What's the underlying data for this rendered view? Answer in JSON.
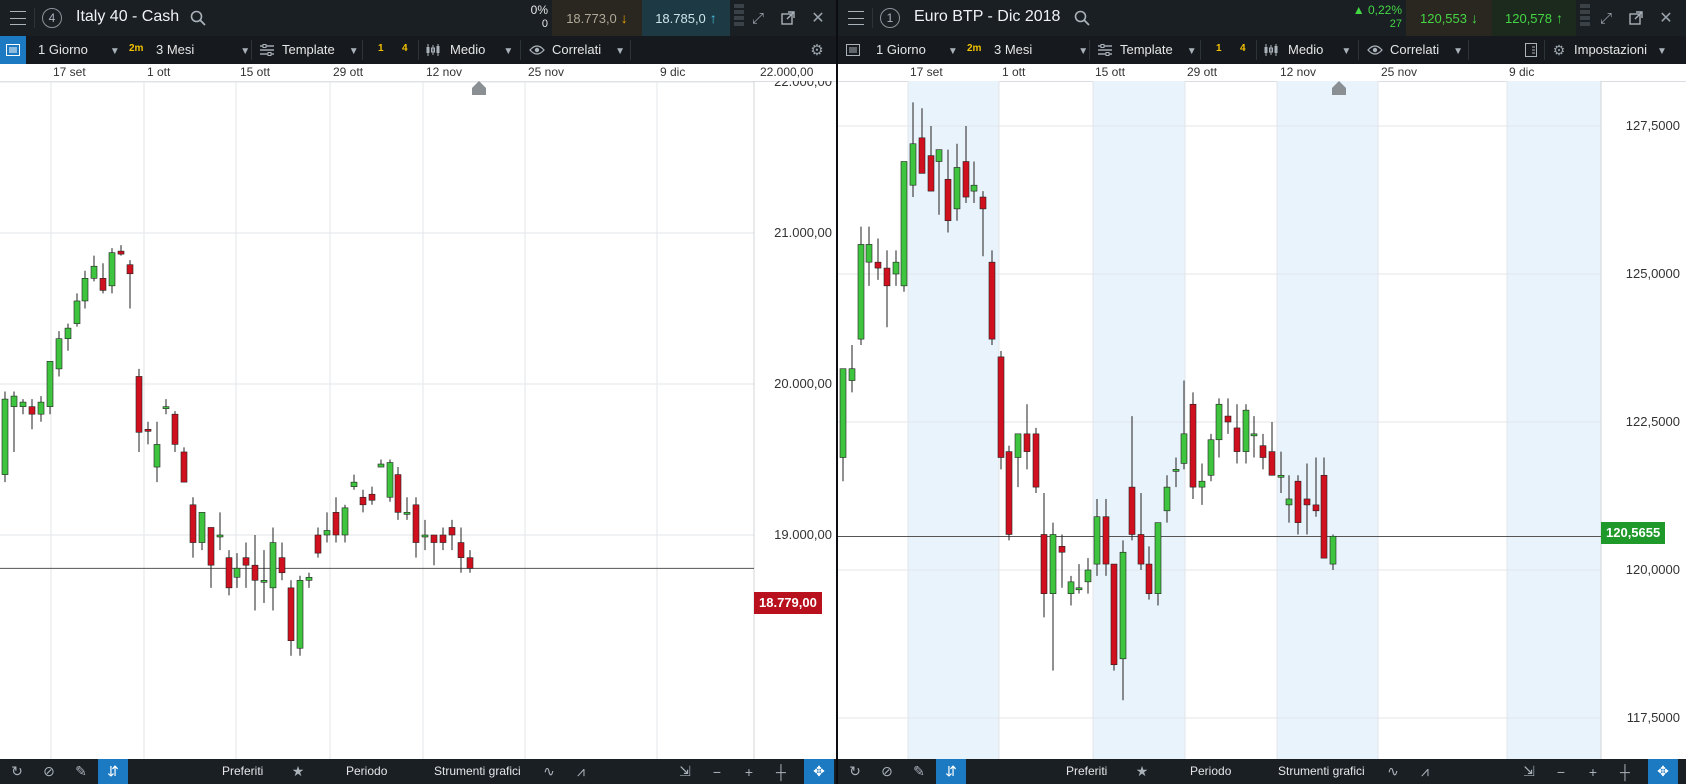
{
  "colors": {
    "up": "#3ec43e",
    "down": "#d0101e",
    "accent_blue": "#1c7ac2",
    "bg_dark": "#1a1f24",
    "bid_bg": "#2a2620",
    "ask_bg": "#1d3a44",
    "last_green_bg": "#1f9a2a",
    "last_red_bg": "#b8101c",
    "band": "#e9f3fc"
  },
  "left": {
    "badge": "4",
    "title": "Italy 40 - Cash",
    "change_pct": "0%",
    "change_pts": "0",
    "bid": "18.773,0",
    "ask": "18.785,0",
    "toolbar": {
      "period": "1 Giorno",
      "timeframe_badge": "2m",
      "range": "3 Mesi",
      "template": "Template",
      "ind1": "1",
      "ind2": "4",
      "style": "Medio",
      "correlati": "Correlati"
    },
    "x_ticks": [
      "17 set",
      "1 ott",
      "15 ott",
      "29 ott",
      "12 nov",
      "25 nov",
      "9 dic"
    ],
    "y_ticks": [
      "22.000,00",
      "21.000,00",
      "20.000,00",
      "19.000,00"
    ],
    "last_price": "18.779,00",
    "bottom": {
      "preferiti": "Preferiti",
      "periodo": "Periodo",
      "strumenti": "Strumenti grafici"
    }
  },
  "right": {
    "badge": "1",
    "title": "Euro BTP - Dic 2018",
    "change_pct": "0,22%",
    "change_pts": "27",
    "bid": "120,553",
    "ask": "120,578",
    "toolbar": {
      "period": "1 Giorno",
      "timeframe_badge": "2m",
      "range": "3 Mesi",
      "template": "Template",
      "ind1": "1",
      "ind2": "4",
      "style": "Medio",
      "correlati": "Correlati",
      "settings": "Impostazioni"
    },
    "x_ticks": [
      "17 set",
      "1 ott",
      "15 ott",
      "29 ott",
      "12 nov",
      "25 nov",
      "9 dic"
    ],
    "y_ticks": [
      "127,5000",
      "125,0000",
      "122,5000",
      "120,0000",
      "117,5000"
    ],
    "last_price": "120,5655",
    "bottom": {
      "preferiti": "Preferiti",
      "periodo": "Periodo",
      "strumenti": "Strumenti grafici"
    }
  },
  "chart_data": [
    {
      "type": "candlestick",
      "title": "Italy 40 - Cash",
      "ylim": [
        18200,
        22050
      ],
      "last": 18779,
      "candles": [
        {
          "o": 19400,
          "h": 19950,
          "l": 19350,
          "c": 19900
        },
        {
          "o": 19850,
          "h": 19950,
          "l": 19550,
          "c": 19920
        },
        {
          "o": 19850,
          "h": 19900,
          "l": 19800,
          "c": 19880
        },
        {
          "o": 19850,
          "h": 19900,
          "l": 19700,
          "c": 19800
        },
        {
          "o": 19800,
          "h": 19920,
          "l": 19750,
          "c": 19880
        },
        {
          "o": 19850,
          "h": 20150,
          "l": 19800,
          "c": 20150
        },
        {
          "o": 20100,
          "h": 20350,
          "l": 20050,
          "c": 20300
        },
        {
          "o": 20300,
          "h": 20400,
          "l": 20220,
          "c": 20370
        },
        {
          "o": 20400,
          "h": 20600,
          "l": 20380,
          "c": 20550
        },
        {
          "o": 20550,
          "h": 20750,
          "l": 20500,
          "c": 20700
        },
        {
          "o": 20700,
          "h": 20850,
          "l": 20680,
          "c": 20780
        },
        {
          "o": 20700,
          "h": 20800,
          "l": 20600,
          "c": 20620
        },
        {
          "o": 20650,
          "h": 20900,
          "l": 20600,
          "c": 20870
        },
        {
          "o": 20880,
          "h": 20920,
          "l": 20850,
          "c": 20860
        },
        {
          "o": 20790,
          "h": 20820,
          "l": 20500,
          "c": 20730
        },
        {
          "o": 20050,
          "h": 20100,
          "l": 19550,
          "c": 19680
        },
        {
          "o": 19700,
          "h": 19750,
          "l": 19600,
          "c": 19690
        },
        {
          "o": 19450,
          "h": 19750,
          "l": 19350,
          "c": 19600
        },
        {
          "o": 19850,
          "h": 19900,
          "l": 19800,
          "c": 19850
        },
        {
          "o": 19800,
          "h": 19820,
          "l": 19550,
          "c": 19600
        },
        {
          "o": 19550,
          "h": 19580,
          "l": 19350,
          "c": 19350
        },
        {
          "o": 19200,
          "h": 19250,
          "l": 18850,
          "c": 18950
        },
        {
          "o": 18950,
          "h": 19150,
          "l": 18900,
          "c": 19150
        },
        {
          "o": 19050,
          "h": 19050,
          "l": 18650,
          "c": 18800
        },
        {
          "o": 19000,
          "h": 19150,
          "l": 18900,
          "c": 19000
        },
        {
          "o": 18850,
          "h": 18900,
          "l": 18600,
          "c": 18650
        },
        {
          "o": 18720,
          "h": 18880,
          "l": 18650,
          "c": 18780
        },
        {
          "o": 18850,
          "h": 18950,
          "l": 18650,
          "c": 18800
        },
        {
          "o": 18800,
          "h": 19000,
          "l": 18500,
          "c": 18700
        },
        {
          "o": 18700,
          "h": 18900,
          "l": 18550,
          "c": 18700
        },
        {
          "o": 18650,
          "h": 19050,
          "l": 18500,
          "c": 18950
        },
        {
          "o": 18850,
          "h": 18950,
          "l": 18700,
          "c": 18750
        },
        {
          "o": 18650,
          "h": 18700,
          "l": 18200,
          "c": 18300
        },
        {
          "o": 18250,
          "h": 18730,
          "l": 18200,
          "c": 18700
        },
        {
          "o": 18700,
          "h": 18750,
          "l": 18650,
          "c": 18720
        },
        {
          "o": 19000,
          "h": 19050,
          "l": 18850,
          "c": 18880
        },
        {
          "o": 19000,
          "h": 19150,
          "l": 18950,
          "c": 19030
        },
        {
          "o": 19150,
          "h": 19250,
          "l": 18950,
          "c": 19000
        },
        {
          "o": 19000,
          "h": 19200,
          "l": 18950,
          "c": 19180
        },
        {
          "o": 19320,
          "h": 19400,
          "l": 19300,
          "c": 19350
        },
        {
          "o": 19250,
          "h": 19300,
          "l": 19150,
          "c": 19200
        },
        {
          "o": 19270,
          "h": 19320,
          "l": 19200,
          "c": 19230
        },
        {
          "o": 19450,
          "h": 19500,
          "l": 19450,
          "c": 19470
        },
        {
          "o": 19250,
          "h": 19500,
          "l": 19220,
          "c": 19480
        },
        {
          "o": 19400,
          "h": 19450,
          "l": 19100,
          "c": 19150
        },
        {
          "o": 19150,
          "h": 19250,
          "l": 19100,
          "c": 19150
        },
        {
          "o": 19200,
          "h": 19250,
          "l": 18850,
          "c": 18950
        },
        {
          "o": 19000,
          "h": 19100,
          "l": 18900,
          "c": 19000
        },
        {
          "o": 19000,
          "h": 19000,
          "l": 18800,
          "c": 18950
        },
        {
          "o": 19000,
          "h": 19050,
          "l": 18900,
          "c": 18950
        },
        {
          "o": 19050,
          "h": 19100,
          "l": 18900,
          "c": 19000
        },
        {
          "o": 18950,
          "h": 19050,
          "l": 18750,
          "c": 18850
        },
        {
          "o": 18850,
          "h": 18900,
          "l": 18750,
          "c": 18779
        }
      ]
    },
    {
      "type": "candlestick",
      "title": "Euro BTP - Dic 2018",
      "ylim": [
        117000,
        128500
      ],
      "last": 120.5655,
      "candles": [
        {
          "o": 121.9,
          "h": 123.0,
          "l": 121.5,
          "c": 123.4
        },
        {
          "o": 123.2,
          "h": 123.8,
          "l": 123.0,
          "c": 123.4
        },
        {
          "o": 123.9,
          "h": 125.8,
          "l": 123.8,
          "c": 125.5
        },
        {
          "o": 125.2,
          "h": 125.8,
          "l": 124.8,
          "c": 125.5
        },
        {
          "o": 125.2,
          "h": 125.6,
          "l": 124.9,
          "c": 125.1
        },
        {
          "o": 125.1,
          "h": 125.4,
          "l": 124.1,
          "c": 124.8
        },
        {
          "o": 125.0,
          "h": 125.4,
          "l": 124.8,
          "c": 125.2
        },
        {
          "o": 124.8,
          "h": 126.1,
          "l": 124.7,
          "c": 126.9
        },
        {
          "o": 126.5,
          "h": 127.9,
          "l": 126.3,
          "c": 127.2
        },
        {
          "o": 127.3,
          "h": 127.8,
          "l": 126.9,
          "c": 126.7
        },
        {
          "o": 127.0,
          "h": 127.5,
          "l": 126.4,
          "c": 126.4
        },
        {
          "o": 126.9,
          "h": 127.1,
          "l": 126.0,
          "c": 127.1
        },
        {
          "o": 126.6,
          "h": 127.1,
          "l": 125.7,
          "c": 125.9
        },
        {
          "o": 126.1,
          "h": 127.2,
          "l": 125.9,
          "c": 126.8
        },
        {
          "o": 126.9,
          "h": 127.5,
          "l": 126.2,
          "c": 126.3
        },
        {
          "o": 126.4,
          "h": 126.9,
          "l": 126.2,
          "c": 126.5
        },
        {
          "o": 126.3,
          "h": 126.4,
          "l": 125.3,
          "c": 126.1
        },
        {
          "o": 125.2,
          "h": 125.4,
          "l": 123.8,
          "c": 123.9
        },
        {
          "o": 123.6,
          "h": 123.7,
          "l": 121.7,
          "c": 121.9
        },
        {
          "o": 122.0,
          "h": 122.1,
          "l": 120.5,
          "c": 120.6
        },
        {
          "o": 121.9,
          "h": 122.3,
          "l": 121.4,
          "c": 122.3
        },
        {
          "o": 122.3,
          "h": 122.8,
          "l": 121.7,
          "c": 122.0
        },
        {
          "o": 122.3,
          "h": 122.4,
          "l": 121.3,
          "c": 121.4
        },
        {
          "o": 120.6,
          "h": 121.3,
          "l": 119.2,
          "c": 119.6
        },
        {
          "o": 119.6,
          "h": 120.8,
          "l": 118.3,
          "c": 120.6
        },
        {
          "o": 120.4,
          "h": 120.6,
          "l": 119.7,
          "c": 120.3
        },
        {
          "o": 119.6,
          "h": 119.9,
          "l": 119.4,
          "c": 119.8
        },
        {
          "o": 119.7,
          "h": 120.1,
          "l": 119.6,
          "c": 119.7
        },
        {
          "o": 119.8,
          "h": 120.2,
          "l": 119.6,
          "c": 120.0
        },
        {
          "o": 120.1,
          "h": 121.2,
          "l": 119.9,
          "c": 120.9
        },
        {
          "o": 120.9,
          "h": 121.2,
          "l": 119.9,
          "c": 120.1
        },
        {
          "o": 120.1,
          "h": 120.1,
          "l": 118.3,
          "c": 118.4
        },
        {
          "o": 118.5,
          "h": 120.5,
          "l": 117.8,
          "c": 120.3
        },
        {
          "o": 121.4,
          "h": 122.6,
          "l": 120.5,
          "c": 120.6
        },
        {
          "o": 120.6,
          "h": 121.3,
          "l": 120.0,
          "c": 120.1
        },
        {
          "o": 120.1,
          "h": 120.4,
          "l": 119.5,
          "c": 119.6
        },
        {
          "o": 119.6,
          "h": 120.8,
          "l": 119.4,
          "c": 120.8
        },
        {
          "o": 121.0,
          "h": 121.6,
          "l": 120.8,
          "c": 121.4
        },
        {
          "o": 121.7,
          "h": 121.9,
          "l": 121.4,
          "c": 121.7
        },
        {
          "o": 121.8,
          "h": 123.2,
          "l": 121.7,
          "c": 122.3
        },
        {
          "o": 122.8,
          "h": 123.0,
          "l": 121.2,
          "c": 121.4
        },
        {
          "o": 121.4,
          "h": 121.8,
          "l": 121.1,
          "c": 121.5
        },
        {
          "o": 121.6,
          "h": 122.3,
          "l": 121.5,
          "c": 122.2
        },
        {
          "o": 122.2,
          "h": 122.9,
          "l": 121.9,
          "c": 122.8
        },
        {
          "o": 122.6,
          "h": 122.9,
          "l": 122.3,
          "c": 122.5
        },
        {
          "o": 122.4,
          "h": 122.8,
          "l": 121.8,
          "c": 122.0
        },
        {
          "o": 122.0,
          "h": 122.8,
          "l": 121.8,
          "c": 122.7
        },
        {
          "o": 122.3,
          "h": 122.6,
          "l": 121.9,
          "c": 122.3
        },
        {
          "o": 122.1,
          "h": 122.3,
          "l": 121.7,
          "c": 121.9
        },
        {
          "o": 122.0,
          "h": 122.5,
          "l": 121.7,
          "c": 121.6
        },
        {
          "o": 121.6,
          "h": 122.0,
          "l": 121.3,
          "c": 121.6
        },
        {
          "o": 121.1,
          "h": 121.6,
          "l": 120.8,
          "c": 121.2
        },
        {
          "o": 121.5,
          "h": 121.6,
          "l": 120.6,
          "c": 120.8
        },
        {
          "o": 121.2,
          "h": 121.8,
          "l": 120.6,
          "c": 121.1
        },
        {
          "o": 121.1,
          "h": 121.9,
          "l": 120.9,
          "c": 121.0
        },
        {
          "o": 121.6,
          "h": 121.9,
          "l": 120.2,
          "c": 120.2
        },
        {
          "o": 120.1,
          "h": 120.6,
          "l": 120.0,
          "c": 120.57
        }
      ]
    }
  ]
}
